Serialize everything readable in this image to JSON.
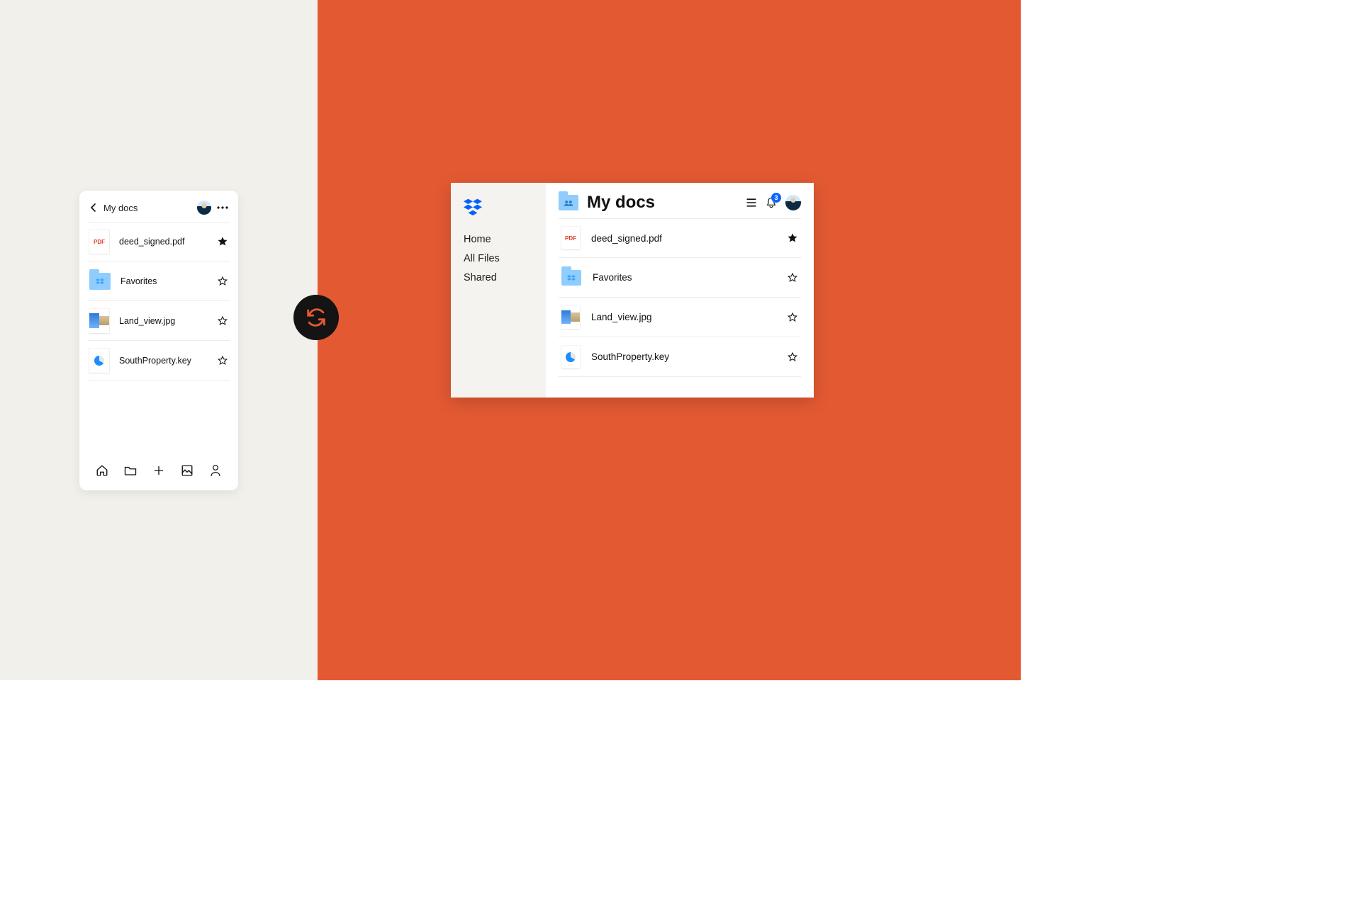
{
  "folder_title": "My docs",
  "notification_count": "3",
  "pdf_label": "PDF",
  "files": [
    {
      "name": "deed_signed.pdf",
      "type": "pdf",
      "starred": true
    },
    {
      "name": "Favorites",
      "type": "folder",
      "starred": false
    },
    {
      "name": "Land_view.jpg",
      "type": "image",
      "starred": false
    },
    {
      "name": "SouthProperty.key",
      "type": "key",
      "starred": false
    }
  ],
  "sidebar": {
    "links": [
      "Home",
      "All Files",
      "Shared"
    ]
  }
}
